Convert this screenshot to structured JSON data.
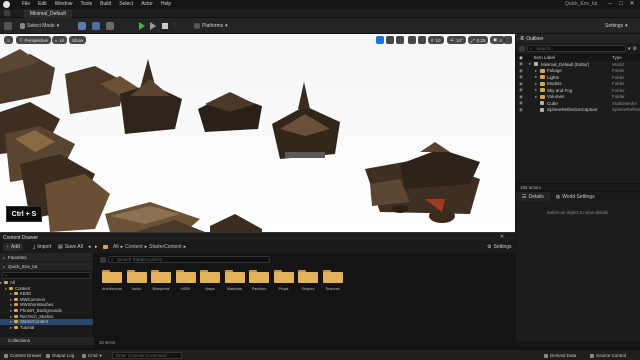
{
  "menubar": {
    "items": [
      "File",
      "Edit",
      "Window",
      "Tools",
      "Build",
      "Select",
      "Actor",
      "Help"
    ],
    "project_name": "Quick_Env_tut"
  },
  "level_tab": {
    "label": "Minimal_Default"
  },
  "toolbar": {
    "select_mode": "Select Mode",
    "platforms": "Platforms",
    "settings": "Settings"
  },
  "viewport": {
    "perspective": "Perspective",
    "lit": "Lit",
    "show": "Show",
    "grid_snap": "10",
    "rotation_snap": "10°",
    "scale_snap": "0.25",
    "camera_speed": "4",
    "shortcut_overlay": "Ctrl + S"
  },
  "outliner": {
    "title": "Outliner",
    "search_placeholder": "Search...",
    "col_label": "Item Label",
    "col_type": "Type",
    "rows": [
      {
        "label": "Minimal_Default (Editor)",
        "type": "World",
        "depth": 0,
        "kind": "world"
      },
      {
        "label": "Foliage",
        "type": "Folder",
        "depth": 1,
        "kind": "folder"
      },
      {
        "label": "Lights",
        "type": "Folder",
        "depth": 1,
        "kind": "folder"
      },
      {
        "label": "Models",
        "type": "Folder",
        "depth": 1,
        "kind": "folder"
      },
      {
        "label": "Sky and Fog",
        "type": "Folder",
        "depth": 1,
        "kind": "folder"
      },
      {
        "label": "Volumes",
        "type": "Folder",
        "depth": 1,
        "kind": "folder"
      },
      {
        "label": "Cube",
        "type": "StaticMeshA",
        "depth": 1,
        "kind": "actor"
      },
      {
        "label": "SphereReflectionCapture",
        "type": "SphereReflect",
        "depth": 1,
        "kind": "actor"
      }
    ],
    "actors_count": "156 actors"
  },
  "details": {
    "tab_details": "Details",
    "tab_world_settings": "World Settings",
    "empty_message": "Select an object to view details."
  },
  "content_drawer": {
    "title": "Content Drawer",
    "add": "Add",
    "import": "Import",
    "save_all": "Save All",
    "breadcrumb": [
      "All",
      "Content",
      "StarterContent"
    ],
    "settings": "Settings",
    "favorites": "Favorites",
    "project": "Quick_Env_tut",
    "search_placeholder": "Search StarterContent",
    "tree": [
      {
        "name": "All",
        "depth": 0,
        "selected": false
      },
      {
        "name": "Content",
        "depth": 1,
        "selected": false
      },
      {
        "name": "KB3D",
        "depth": 2,
        "selected": false
      },
      {
        "name": "MWCommon",
        "depth": 2,
        "selected": false
      },
      {
        "name": "MWShoreBushes",
        "depth": 2,
        "selected": false
      },
      {
        "name": "PhotoR_Backgrounds",
        "depth": 2,
        "selected": false
      },
      {
        "name": "RecTech_Studios",
        "depth": 2,
        "selected": false
      },
      {
        "name": "StarterContent",
        "depth": 2,
        "selected": true
      },
      {
        "name": "Tutorial",
        "depth": 2,
        "selected": false
      }
    ],
    "collections": "Collections",
    "assets": [
      "Architecture",
      "Audio",
      "Blueprints",
      "HDRI",
      "Maps",
      "Materials",
      "Particles",
      "Props",
      "Shapes",
      "Textures"
    ],
    "items_count": "10 items"
  },
  "statusbar": {
    "content_drawer": "Content Drawer",
    "output_log": "Output Log",
    "cmd": "Cmd",
    "console_placeholder": "Enter Console Command",
    "derived_data": "Derived Data",
    "source_control": "Source Control"
  },
  "colors": {
    "accent_blue": "#1a73d8",
    "folder": "#e2b35a",
    "play_green": "#4caf50",
    "panel_bg": "#1c1c1c"
  }
}
